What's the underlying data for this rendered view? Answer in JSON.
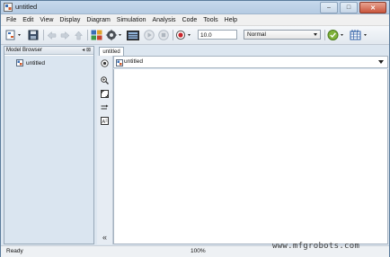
{
  "window": {
    "title": "untitled",
    "minimize": "–",
    "maximize": "□",
    "close": "✕"
  },
  "menubar": {
    "items": [
      "File",
      "Edit",
      "View",
      "Display",
      "Diagram",
      "Simulation",
      "Analysis",
      "Code",
      "Tools",
      "Help"
    ]
  },
  "toolbar": {
    "stop_time": "10.0",
    "sim_mode": "Normal"
  },
  "model_browser": {
    "title": "Model Browser",
    "controls": "◂ ⊠",
    "items": [
      {
        "label": "untitled"
      }
    ]
  },
  "editor": {
    "tabs": [
      {
        "label": "untitled"
      }
    ],
    "breadcrumb": "untitled"
  },
  "palette": {
    "collapse_label": "«"
  },
  "statusbar": {
    "status": "Ready",
    "zoom": "100%"
  },
  "watermark": "www.mfgrobots.com",
  "colors": {
    "accent": "#5b7c9c",
    "canvas": "#ffffff",
    "panel": "#dae5f0"
  }
}
